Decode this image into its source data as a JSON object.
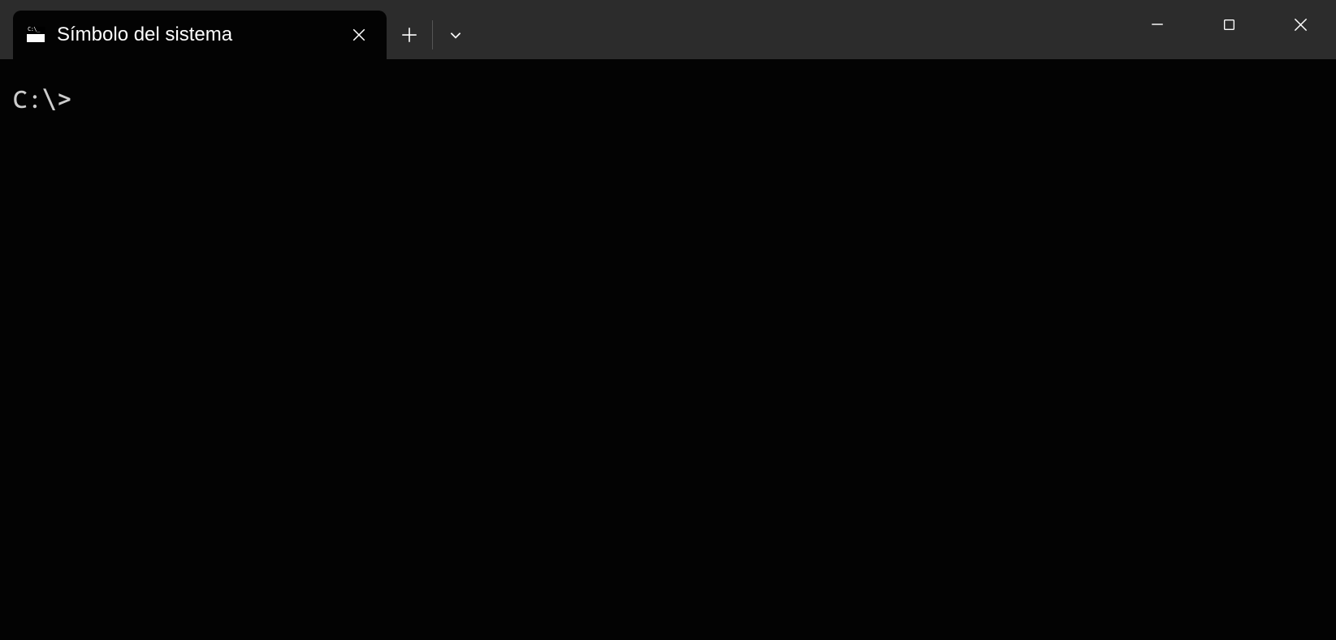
{
  "tab": {
    "title": "Símbolo del sistema"
  },
  "terminal": {
    "prompt": "C:\\>"
  }
}
